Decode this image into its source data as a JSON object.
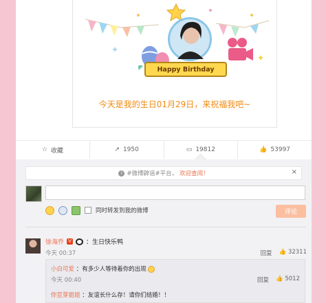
{
  "post": {
    "birthday_banner": "Happy Birthday",
    "message": "今天是我的生日01月29日，来祝福我吧~"
  },
  "actions": [
    {
      "icon": "star-icon",
      "label": "收藏"
    },
    {
      "icon": "share-icon",
      "label": "1950"
    },
    {
      "icon": "comment-icon",
      "label": "19812"
    },
    {
      "icon": "like-icon",
      "label": "53997"
    }
  ],
  "notice": {
    "prefix": "#微博辟谣#平台，",
    "link": "欢迎查阅！",
    "close": "×"
  },
  "composer": {
    "value": "",
    "repost_label": "同时转发到我的微博",
    "submit_label": "评论"
  },
  "comment": {
    "author": "徐海乔",
    "badge": "V",
    "text": "：生日快乐鸭",
    "time": "今天 00:37",
    "reply_label": "回复",
    "likes": "32311"
  },
  "replies": [
    {
      "author": "小白可爱",
      "text": "：有多少人等待着你的出现",
      "time": "今天 00:40",
      "reply_label": "回复",
      "likes": "5012"
    },
    {
      "author": "你豆芽姐姐",
      "text": "：友谊长什么存！请你们结婚！！"
    }
  ],
  "colors": {
    "background": "#f7c6d3",
    "accent": "#eb7350",
    "message": "#f08a0f"
  }
}
